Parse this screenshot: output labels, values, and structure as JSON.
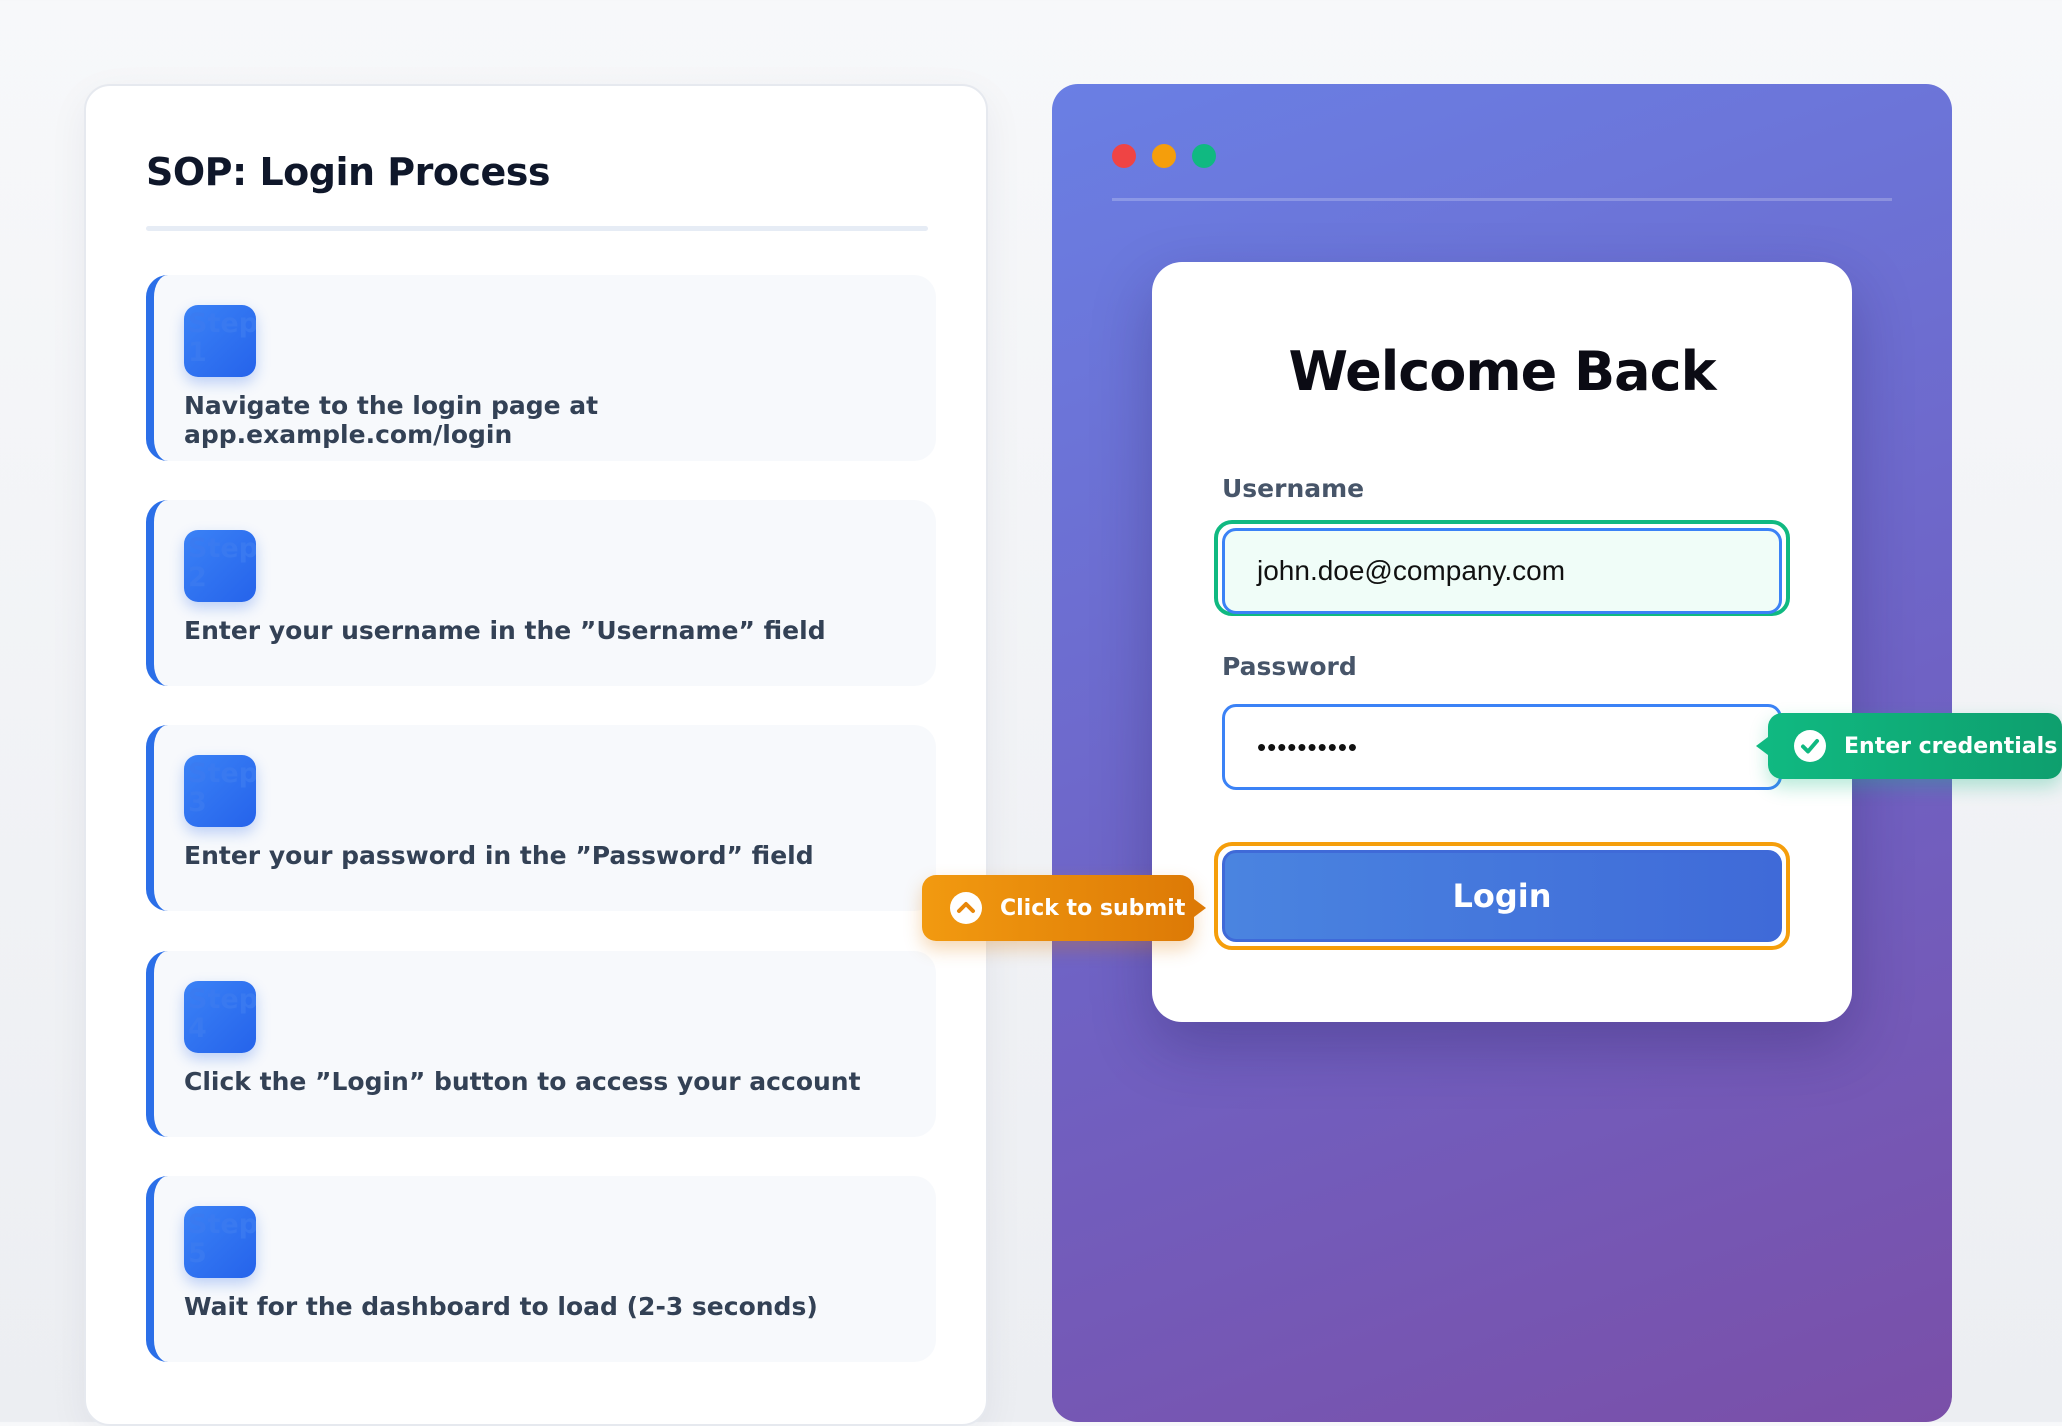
{
  "sop": {
    "title": "SOP: Login Process",
    "steps": [
      {
        "badge": "Step 1",
        "text": "Navigate to the login page at app.example.com/login"
      },
      {
        "badge": "Step 2",
        "text": "Enter your username in the ”Username” field"
      },
      {
        "badge": "Step 3",
        "text": "Enter your password in the ”Password” field"
      },
      {
        "badge": "Step 4",
        "text": "Click the ”Login” button to access your account"
      },
      {
        "badge": "Step 5",
        "text": "Wait for the dashboard to load (2-3 seconds)"
      }
    ]
  },
  "browser": {
    "window_dots": [
      "#ef4444",
      "#f59e0b",
      "#10b981"
    ],
    "login_form": {
      "title": "Welcome Back",
      "username_label": "Username",
      "username_value": "john.doe@company.com",
      "password_label": "Password",
      "password_value": "••••••••••",
      "login_button": "Login"
    }
  },
  "callouts": {
    "credentials": {
      "text": "Enter credentials",
      "icon": "check-circle-icon",
      "color": "#10b981"
    },
    "submit": {
      "text": "Click to submit",
      "icon": "chevron-up-circle-icon",
      "color": "#f29a10"
    }
  },
  "colors": {
    "accent": "#2b6fe8",
    "highlight_username": "#10b981",
    "highlight_login": "#f59e0b"
  }
}
